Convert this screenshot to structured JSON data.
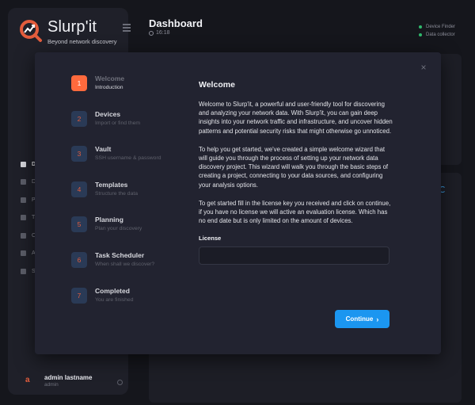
{
  "app": {
    "brand_name": "Slurp'it",
    "brand_tagline": "Beyond network discovery",
    "brand_color": "#e35d3d"
  },
  "sidebar": {
    "items": [
      {
        "label": "D",
        "icon": "grid-icon",
        "active": true
      },
      {
        "label": "D",
        "icon": "monitor-icon",
        "active": false
      },
      {
        "label": "P",
        "icon": "pencil-icon",
        "active": false
      },
      {
        "label": "T",
        "icon": "tag-icon",
        "active": false
      },
      {
        "label": "C",
        "icon": "database-icon",
        "active": false
      },
      {
        "label": "A",
        "icon": "users-icon",
        "active": false
      },
      {
        "label": "S",
        "icon": "gear-icon",
        "active": false
      }
    ],
    "user": {
      "initial": "a",
      "name": "admin lastname",
      "role": "admin"
    }
  },
  "header": {
    "title": "Dashboard",
    "time": "16:18",
    "status": [
      {
        "label": "Device Finder",
        "color": "#2fb86c"
      },
      {
        "label": "Data collector",
        "color": "#2fb86c"
      }
    ]
  },
  "wizard": {
    "close_label": "×",
    "steps": [
      {
        "number": "1",
        "title": "Welcome",
        "subtitle": "Introduction",
        "active": true
      },
      {
        "number": "2",
        "title": "Devices",
        "subtitle": "Import or find them",
        "active": false
      },
      {
        "number": "3",
        "title": "Vault",
        "subtitle": "SSH username & password",
        "active": false
      },
      {
        "number": "4",
        "title": "Templates",
        "subtitle": "Structure the data",
        "active": false
      },
      {
        "number": "5",
        "title": "Planning",
        "subtitle": "Plan your discovery",
        "active": false
      },
      {
        "number": "6",
        "title": "Task Scheduler",
        "subtitle": "When shall we discover?",
        "active": false
      },
      {
        "number": "7",
        "title": "Completed",
        "subtitle": "You are finished",
        "active": false
      }
    ],
    "content": {
      "heading": "Welcome",
      "paragraphs": [
        "Welcome to Slurp'it, a powerful and user-friendly tool for discovering and analyzing your network data. With Slurp'it, you can gain deep insights into your network traffic and infrastructure, and uncover hidden patterns and potential security risks that might otherwise go unnoticed.",
        "To help you get started, we've created a simple welcome wizard that will guide you through the process of setting up your network data discovery project. This wizard will walk you through the basic steps of creating a project, connecting to your data sources, and configuring your analysis options.",
        "To get started fill in the license key you received and click on continue, if you have no license we will active an evaluation license. Which has no end date but is only limited on the amount of devices."
      ],
      "license_label": "License",
      "license_value": "",
      "license_placeholder": ""
    },
    "continue_label": "Continue",
    "accent_color": "#1b96f0",
    "active_step_color": "#ff6a3d"
  }
}
